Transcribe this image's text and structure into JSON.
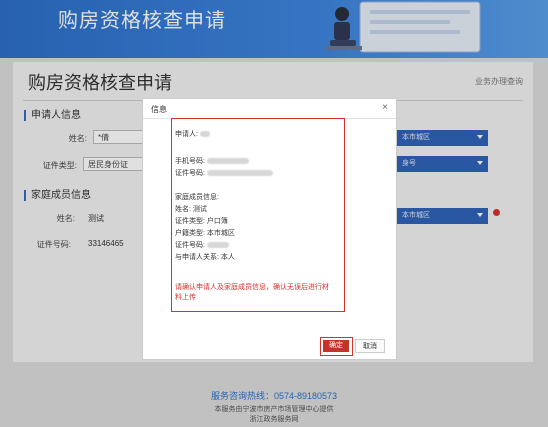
{
  "banner": {
    "title": "购房资格核查申请"
  },
  "page": {
    "title": "购房资格核查申请",
    "top_link": "业务办理查询",
    "applicant_section": "申请人信息",
    "applicant_name_label": "姓名:",
    "applicant_name_value": "*倩",
    "id_type_label": "证件类型:",
    "id_type_value": "居民身份证",
    "right_select_1": "本市城区",
    "right_select_2": "身号",
    "family_section": "家庭成员信息",
    "family_name_label": "姓名:",
    "family_name_value": "测试",
    "family_id_label": "证件号码:",
    "family_id_value": "33146465",
    "right_select_3": "本市城区"
  },
  "dialog": {
    "title": "信息",
    "close": "×",
    "applicant_label": "申请人:",
    "phone_label": "手机号码:",
    "idno_label": "证件号码:",
    "family_header": "家庭成员信息:",
    "fm_name": "姓名: 测试",
    "fm_idtype": "证件类型: 户口簿",
    "fm_hukou": "户籍类型: 本市城区",
    "fm_idno_label": "证件号码:",
    "fm_relation": "与申请人关系: 本人",
    "notice": "请确认申请人及家庭成员信息，确认无误后进行材料上传",
    "ok": "确定",
    "cancel": "取消"
  },
  "footer": {
    "hotline": "服务咨询热线：0574-89180573",
    "line1": "本服务由宁波市房产市场管理中心提供",
    "line2": "浙江政务服务网"
  },
  "colors": {
    "brand_blue": "#2d6fc9",
    "alert_red": "#d9302c"
  }
}
